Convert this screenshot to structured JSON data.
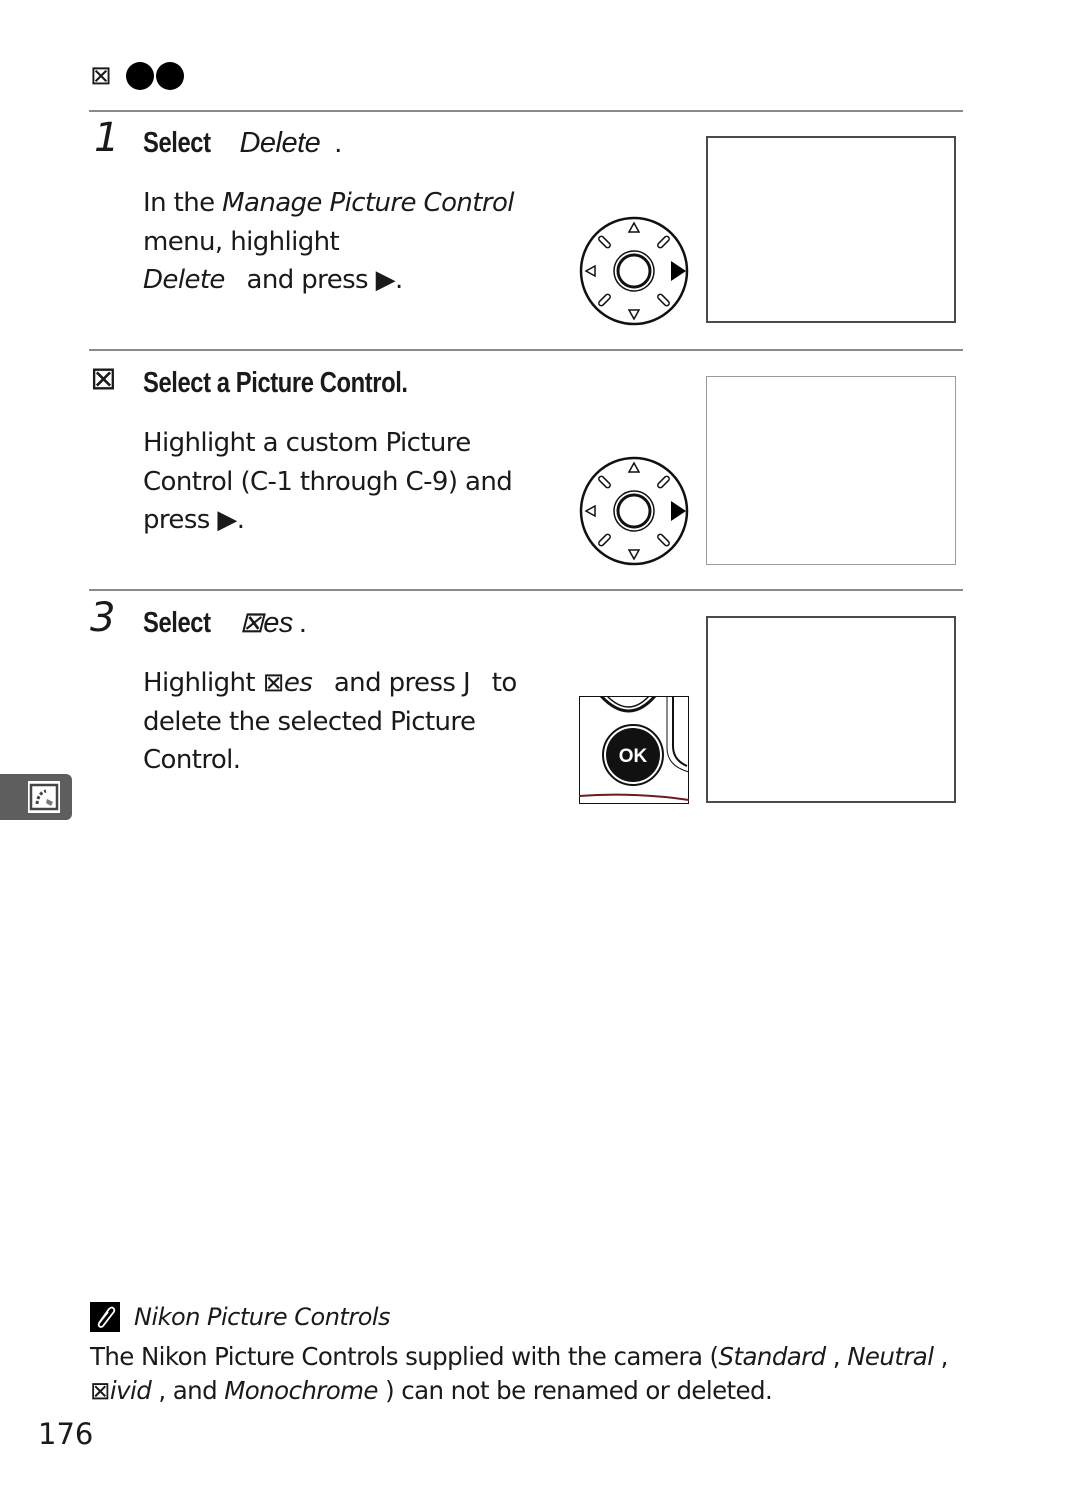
{
  "heading": {
    "glyph": "⊠"
  },
  "steps": [
    {
      "number": "1",
      "title_bold": "Select",
      "title_italic": "Delete",
      "title_end": ".",
      "body": {
        "p1": "In the ",
        "i1": "Manage Picture Control",
        "p2": " menu, highlight ",
        "i2": "Delete",
        "p3": " and press ▶."
      },
      "illustration": "multi-selector-right"
    },
    {
      "number": "⊠",
      "title_bold": "Select a Picture Control.",
      "body": {
        "p1": "Highlight a custom Picture Control (C-1 through C-9) and press ▶."
      },
      "illustration": "multi-selector-right"
    },
    {
      "number": "3",
      "title_bold": "Select",
      "title_italic": "⊠es",
      "title_end": ".",
      "body": {
        "p1": "Highlight ",
        "i1": "⊠es",
        "p2": " and press J",
        "p3": " to delete the selected Picture Control."
      },
      "illustration": "ok-button",
      "ok_label": "OK"
    }
  ],
  "side_tab": {
    "icon": "picture-control-icon"
  },
  "note": {
    "icon": "paperclip-icon",
    "title": "Nikon Picture Controls",
    "t1": "The Nikon Picture Controls supplied with the camera (",
    "i1": "Standard",
    "t2": " , ",
    "i2": "Neutral",
    "t3": " , ",
    "i3": "⊠ivid",
    "t4": " , and ",
    "i4": "Monochrome",
    "t5": " ) can not be renamed or deleted."
  },
  "page_number": "176"
}
